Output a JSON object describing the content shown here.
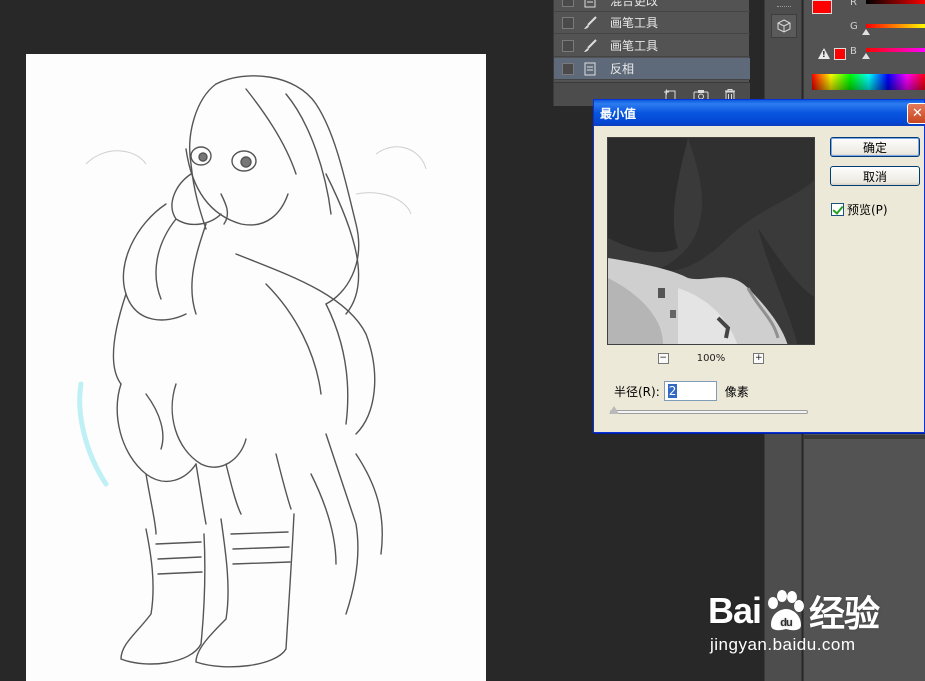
{
  "history": {
    "items": [
      {
        "label": "混合更改",
        "active": false
      },
      {
        "label": "画笔工具",
        "active": false
      },
      {
        "label": "画笔工具",
        "active": false
      },
      {
        "label": "反相",
        "active": true
      }
    ]
  },
  "color_panel": {
    "channels": [
      "R",
      "G",
      "B"
    ],
    "foreground": "#ff0000",
    "background": "#ffffff"
  },
  "dialog": {
    "title": "最小值",
    "ok_label": "确定",
    "cancel_label": "取消",
    "preview_label": "预览(P)",
    "preview_checked": true,
    "zoom_out": "−",
    "zoom_in": "+",
    "zoom_level": "100%",
    "radius_label": "半径(R):",
    "radius_value": "2",
    "radius_unit": "像素"
  },
  "watermark": {
    "brand_left": "Bai",
    "brand_right": "经验",
    "url": "jingyan.baidu.com"
  },
  "colors": {
    "dialog_title_blue": "#0755e0",
    "panel_gray": "#535353",
    "workspace": "#282828"
  }
}
